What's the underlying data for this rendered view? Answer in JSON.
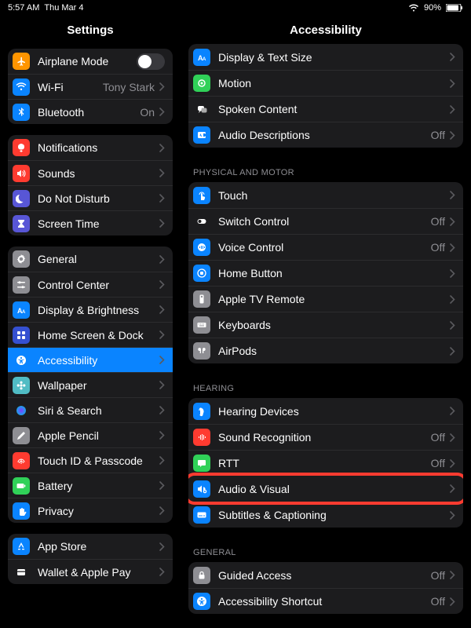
{
  "status": {
    "time": "5:57 AM",
    "date": "Thu Mar 4",
    "battery_pct": "90%"
  },
  "titles": {
    "sidebar": "Settings",
    "detail": "Accessibility"
  },
  "sidebar_groups": [
    [
      {
        "label": "Airplane Mode",
        "icon": "airplane",
        "color": "#ff9500",
        "switch": false
      },
      {
        "label": "Wi-Fi",
        "icon": "wifi",
        "color": "#0a84ff",
        "value": "Tony Stark"
      },
      {
        "label": "Bluetooth",
        "icon": "bluetooth",
        "color": "#0a84ff",
        "value": "On"
      }
    ],
    [
      {
        "label": "Notifications",
        "icon": "bell",
        "color": "#ff3b30"
      },
      {
        "label": "Sounds",
        "icon": "speaker",
        "color": "#ff3b30"
      },
      {
        "label": "Do Not Disturb",
        "icon": "moon",
        "color": "#5856d6"
      },
      {
        "label": "Screen Time",
        "icon": "hourglass",
        "color": "#5856d6"
      }
    ],
    [
      {
        "label": "General",
        "icon": "gear",
        "color": "#8e8e93"
      },
      {
        "label": "Control Center",
        "icon": "sliders",
        "color": "#8e8e93"
      },
      {
        "label": "Display & Brightness",
        "icon": "textsize",
        "color": "#0a84ff"
      },
      {
        "label": "Home Screen & Dock",
        "icon": "grid",
        "color": "#3550d1"
      },
      {
        "label": "Accessibility",
        "icon": "accessibility",
        "color": "#0a84ff",
        "selected": true
      },
      {
        "label": "Wallpaper",
        "icon": "flower",
        "color": "#50bcc4"
      },
      {
        "label": "Siri & Search",
        "icon": "siri",
        "color": "#1c1c1e"
      },
      {
        "label": "Apple Pencil",
        "icon": "pencil",
        "color": "#8e8e93"
      },
      {
        "label": "Touch ID & Passcode",
        "icon": "fingerprint",
        "color": "#ff3b30"
      },
      {
        "label": "Battery",
        "icon": "battery",
        "color": "#30d158"
      },
      {
        "label": "Privacy",
        "icon": "hand",
        "color": "#0a84ff"
      }
    ],
    [
      {
        "label": "App Store",
        "icon": "appstore",
        "color": "#0a84ff"
      },
      {
        "label": "Wallet & Apple Pay",
        "icon": "wallet",
        "color": "#1c1c1e"
      }
    ]
  ],
  "detail_sections": [
    {
      "header": null,
      "rows": [
        {
          "label": "Display & Text Size",
          "icon": "textsize",
          "color": "#0a84ff"
        },
        {
          "label": "Motion",
          "icon": "motion",
          "color": "#30d158"
        },
        {
          "label": "Spoken Content",
          "icon": "speech",
          "color": "#1c1c1e"
        },
        {
          "label": "Audio Descriptions",
          "icon": "ad",
          "color": "#0a84ff",
          "value": "Off"
        }
      ]
    },
    {
      "header": "PHYSICAL AND MOTOR",
      "rows": [
        {
          "label": "Touch",
          "icon": "touch",
          "color": "#0a84ff"
        },
        {
          "label": "Switch Control",
          "icon": "switchctl",
          "color": "#1c1c1e",
          "value": "Off"
        },
        {
          "label": "Voice Control",
          "icon": "voice",
          "color": "#0a84ff",
          "value": "Off"
        },
        {
          "label": "Home Button",
          "icon": "homebtn",
          "color": "#0a84ff"
        },
        {
          "label": "Apple TV Remote",
          "icon": "remote",
          "color": "#8e8e93"
        },
        {
          "label": "Keyboards",
          "icon": "keyboard",
          "color": "#8e8e93"
        },
        {
          "label": "AirPods",
          "icon": "airpods",
          "color": "#8e8e93"
        }
      ]
    },
    {
      "header": "HEARING",
      "rows": [
        {
          "label": "Hearing Devices",
          "icon": "ear",
          "color": "#0a84ff"
        },
        {
          "label": "Sound Recognition",
          "icon": "soundrec",
          "color": "#ff3b30",
          "value": "Off"
        },
        {
          "label": "RTT",
          "icon": "rtt",
          "color": "#30d158",
          "value": "Off"
        },
        {
          "label": "Audio & Visual",
          "icon": "audiovisual",
          "color": "#0a84ff",
          "highlight": true
        },
        {
          "label": "Subtitles & Captioning",
          "icon": "subtitles",
          "color": "#0a84ff"
        }
      ]
    },
    {
      "header": "GENERAL",
      "rows": [
        {
          "label": "Guided Access",
          "icon": "lock",
          "color": "#8e8e93",
          "value": "Off"
        },
        {
          "label": "Accessibility Shortcut",
          "icon": "accessibility",
          "color": "#0a84ff",
          "value": "Off"
        }
      ]
    }
  ]
}
